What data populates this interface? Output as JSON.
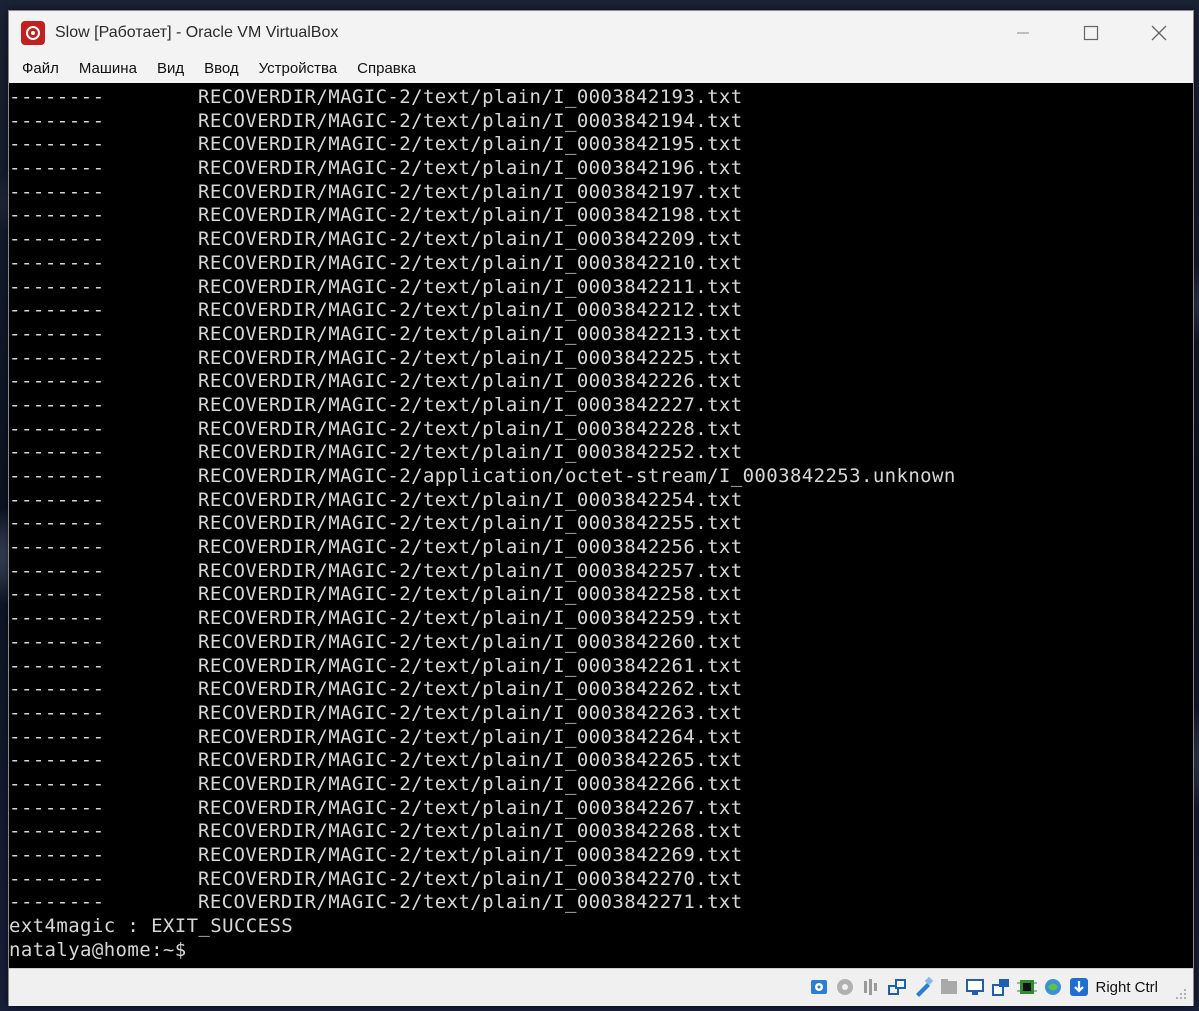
{
  "window": {
    "title": "Slow [Работает] - Oracle VM VirtualBox",
    "controls": [
      "minimize",
      "maximize",
      "close"
    ]
  },
  "menu": [
    "Файл",
    "Машина",
    "Вид",
    "Ввод",
    "Устройства",
    "Справка"
  ],
  "terminal": {
    "permissions": "--------",
    "file_lines": [
      "RECOVERDIR/MAGIC-2/text/plain/I_0003842193.txt",
      "RECOVERDIR/MAGIC-2/text/plain/I_0003842194.txt",
      "RECOVERDIR/MAGIC-2/text/plain/I_0003842195.txt",
      "RECOVERDIR/MAGIC-2/text/plain/I_0003842196.txt",
      "RECOVERDIR/MAGIC-2/text/plain/I_0003842197.txt",
      "RECOVERDIR/MAGIC-2/text/plain/I_0003842198.txt",
      "RECOVERDIR/MAGIC-2/text/plain/I_0003842209.txt",
      "RECOVERDIR/MAGIC-2/text/plain/I_0003842210.txt",
      "RECOVERDIR/MAGIC-2/text/plain/I_0003842211.txt",
      "RECOVERDIR/MAGIC-2/text/plain/I_0003842212.txt",
      "RECOVERDIR/MAGIC-2/text/plain/I_0003842213.txt",
      "RECOVERDIR/MAGIC-2/text/plain/I_0003842225.txt",
      "RECOVERDIR/MAGIC-2/text/plain/I_0003842226.txt",
      "RECOVERDIR/MAGIC-2/text/plain/I_0003842227.txt",
      "RECOVERDIR/MAGIC-2/text/plain/I_0003842228.txt",
      "RECOVERDIR/MAGIC-2/text/plain/I_0003842252.txt",
      "RECOVERDIR/MAGIC-2/application/octet-stream/I_0003842253.unknown",
      "RECOVERDIR/MAGIC-2/text/plain/I_0003842254.txt",
      "RECOVERDIR/MAGIC-2/text/plain/I_0003842255.txt",
      "RECOVERDIR/MAGIC-2/text/plain/I_0003842256.txt",
      "RECOVERDIR/MAGIC-2/text/plain/I_0003842257.txt",
      "RECOVERDIR/MAGIC-2/text/plain/I_0003842258.txt",
      "RECOVERDIR/MAGIC-2/text/plain/I_0003842259.txt",
      "RECOVERDIR/MAGIC-2/text/plain/I_0003842260.txt",
      "RECOVERDIR/MAGIC-2/text/plain/I_0003842261.txt",
      "RECOVERDIR/MAGIC-2/text/plain/I_0003842262.txt",
      "RECOVERDIR/MAGIC-2/text/plain/I_0003842263.txt",
      "RECOVERDIR/MAGIC-2/text/plain/I_0003842264.txt",
      "RECOVERDIR/MAGIC-2/text/plain/I_0003842265.txt",
      "RECOVERDIR/MAGIC-2/text/plain/I_0003842266.txt",
      "RECOVERDIR/MAGIC-2/text/plain/I_0003842267.txt",
      "RECOVERDIR/MAGIC-2/text/plain/I_0003842268.txt",
      "RECOVERDIR/MAGIC-2/text/plain/I_0003842269.txt",
      "RECOVERDIR/MAGIC-2/text/plain/I_0003842270.txt",
      "RECOVERDIR/MAGIC-2/text/plain/I_0003842271.txt"
    ],
    "exit_line": "ext4magic : EXIT_SUCCESS",
    "prompt": "natalya@home:~$"
  },
  "statusbar": {
    "host_key": "Right Ctrl",
    "tray_icons": [
      "hard-disk-icon",
      "optical-drive-icon",
      "audio-icon",
      "network-icon",
      "usb-icon",
      "shared-folders-icon",
      "display-icon",
      "recording-icon",
      "cpu-icon",
      "mouse-integration-icon",
      "keyboard-capture-icon"
    ]
  }
}
